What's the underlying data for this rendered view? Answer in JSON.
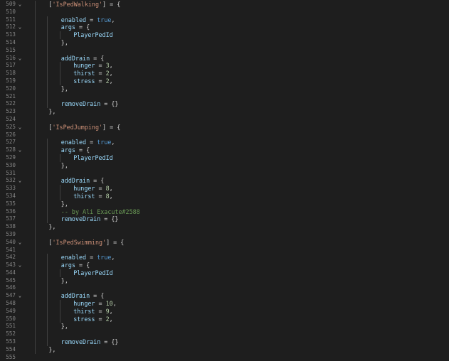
{
  "editor": {
    "lines": [
      {
        "n": "509",
        "fold": "⌄",
        "indent": 1,
        "tokens": [
          {
            "c": "t-pun",
            "t": "["
          },
          {
            "c": "t-str",
            "t": "'IsPedWalking'"
          },
          {
            "c": "t-pun",
            "t": "] = {"
          }
        ]
      },
      {
        "n": "510",
        "fold": "",
        "indent": 0,
        "tokens": []
      },
      {
        "n": "511",
        "fold": "",
        "indent": 2,
        "tokens": [
          {
            "c": "t-id",
            "t": "enabled"
          },
          {
            "c": "t-pun",
            "t": " = "
          },
          {
            "c": "t-kw",
            "t": "true"
          },
          {
            "c": "t-pun",
            "t": ","
          }
        ]
      },
      {
        "n": "512",
        "fold": "⌄",
        "indent": 2,
        "tokens": [
          {
            "c": "t-id",
            "t": "args"
          },
          {
            "c": "t-pun",
            "t": " = {"
          }
        ]
      },
      {
        "n": "513",
        "fold": "",
        "indent": 3,
        "tokens": [
          {
            "c": "t-fn",
            "t": "PlayerPedId"
          }
        ]
      },
      {
        "n": "514",
        "fold": "",
        "indent": 2,
        "tokens": [
          {
            "c": "t-pun",
            "t": "},"
          }
        ]
      },
      {
        "n": "515",
        "fold": "",
        "indent": 0,
        "tokens": []
      },
      {
        "n": "516",
        "fold": "⌄",
        "indent": 2,
        "tokens": [
          {
            "c": "t-id",
            "t": "addDrain"
          },
          {
            "c": "t-pun",
            "t": " = {"
          }
        ]
      },
      {
        "n": "517",
        "fold": "",
        "indent": 3,
        "tokens": [
          {
            "c": "t-id",
            "t": "hunger"
          },
          {
            "c": "t-pun",
            "t": " = "
          },
          {
            "c": "t-num",
            "t": "3"
          },
          {
            "c": "t-pun",
            "t": ","
          }
        ]
      },
      {
        "n": "518",
        "fold": "",
        "indent": 3,
        "tokens": [
          {
            "c": "t-id",
            "t": "thirst"
          },
          {
            "c": "t-pun",
            "t": " = "
          },
          {
            "c": "t-num",
            "t": "2"
          },
          {
            "c": "t-pun",
            "t": ","
          }
        ]
      },
      {
        "n": "519",
        "fold": "",
        "indent": 3,
        "tokens": [
          {
            "c": "t-id",
            "t": "stress"
          },
          {
            "c": "t-pun",
            "t": " = "
          },
          {
            "c": "t-num",
            "t": "2"
          },
          {
            "c": "t-pun",
            "t": ","
          }
        ]
      },
      {
        "n": "520",
        "fold": "",
        "indent": 2,
        "tokens": [
          {
            "c": "t-pun",
            "t": "},"
          }
        ]
      },
      {
        "n": "521",
        "fold": "",
        "indent": 0,
        "tokens": []
      },
      {
        "n": "522",
        "fold": "",
        "indent": 2,
        "tokens": [
          {
            "c": "t-id",
            "t": "removeDrain"
          },
          {
            "c": "t-pun",
            "t": " = {}"
          }
        ]
      },
      {
        "n": "523",
        "fold": "",
        "indent": 1,
        "tokens": [
          {
            "c": "t-pun",
            "t": "},"
          }
        ]
      },
      {
        "n": "524",
        "fold": "",
        "indent": 0,
        "tokens": []
      },
      {
        "n": "525",
        "fold": "⌄",
        "indent": 1,
        "tokens": [
          {
            "c": "t-pun",
            "t": "["
          },
          {
            "c": "t-str",
            "t": "'IsPedJumping'"
          },
          {
            "c": "t-pun",
            "t": "] = {"
          }
        ]
      },
      {
        "n": "526",
        "fold": "",
        "indent": 0,
        "tokens": []
      },
      {
        "n": "527",
        "fold": "",
        "indent": 2,
        "tokens": [
          {
            "c": "t-id",
            "t": "enabled"
          },
          {
            "c": "t-pun",
            "t": " = "
          },
          {
            "c": "t-kw",
            "t": "true"
          },
          {
            "c": "t-pun",
            "t": ","
          }
        ]
      },
      {
        "n": "528",
        "fold": "⌄",
        "indent": 2,
        "tokens": [
          {
            "c": "t-id",
            "t": "args"
          },
          {
            "c": "t-pun",
            "t": " = {"
          }
        ]
      },
      {
        "n": "529",
        "fold": "",
        "indent": 3,
        "tokens": [
          {
            "c": "t-fn",
            "t": "PlayerPedId"
          }
        ]
      },
      {
        "n": "530",
        "fold": "",
        "indent": 2,
        "tokens": [
          {
            "c": "t-pun",
            "t": "},"
          }
        ]
      },
      {
        "n": "531",
        "fold": "",
        "indent": 0,
        "tokens": []
      },
      {
        "n": "532",
        "fold": "⌄",
        "indent": 2,
        "tokens": [
          {
            "c": "t-id",
            "t": "addDrain"
          },
          {
            "c": "t-pun",
            "t": " = {"
          }
        ]
      },
      {
        "n": "533",
        "fold": "",
        "indent": 3,
        "tokens": [
          {
            "c": "t-id",
            "t": "hunger"
          },
          {
            "c": "t-pun",
            "t": " = "
          },
          {
            "c": "t-num",
            "t": "8"
          },
          {
            "c": "t-pun",
            "t": ","
          }
        ]
      },
      {
        "n": "534",
        "fold": "",
        "indent": 3,
        "tokens": [
          {
            "c": "t-id",
            "t": "thirst"
          },
          {
            "c": "t-pun",
            "t": " = "
          },
          {
            "c": "t-num",
            "t": "8"
          },
          {
            "c": "t-pun",
            "t": ","
          }
        ]
      },
      {
        "n": "535",
        "fold": "",
        "indent": 2,
        "tokens": [
          {
            "c": "t-pun",
            "t": "},"
          }
        ]
      },
      {
        "n": "536",
        "fold": "",
        "indent": 2,
        "tokens": [
          {
            "c": "t-cmt",
            "t": "-- by Ali Exacute#2588"
          }
        ]
      },
      {
        "n": "537",
        "fold": "",
        "indent": 2,
        "tokens": [
          {
            "c": "t-id",
            "t": "removeDrain"
          },
          {
            "c": "t-pun",
            "t": " = {}"
          }
        ]
      },
      {
        "n": "538",
        "fold": "",
        "indent": 1,
        "tokens": [
          {
            "c": "t-pun",
            "t": "},"
          }
        ]
      },
      {
        "n": "539",
        "fold": "",
        "indent": 0,
        "tokens": []
      },
      {
        "n": "540",
        "fold": "⌄",
        "indent": 1,
        "tokens": [
          {
            "c": "t-pun",
            "t": "["
          },
          {
            "c": "t-str",
            "t": "'IsPedSwimming'"
          },
          {
            "c": "t-pun",
            "t": "] = {"
          }
        ]
      },
      {
        "n": "541",
        "fold": "",
        "indent": 0,
        "tokens": []
      },
      {
        "n": "542",
        "fold": "",
        "indent": 2,
        "tokens": [
          {
            "c": "t-id",
            "t": "enabled"
          },
          {
            "c": "t-pun",
            "t": " = "
          },
          {
            "c": "t-kw",
            "t": "true"
          },
          {
            "c": "t-pun",
            "t": ","
          }
        ]
      },
      {
        "n": "543",
        "fold": "⌄",
        "indent": 2,
        "tokens": [
          {
            "c": "t-id",
            "t": "args"
          },
          {
            "c": "t-pun",
            "t": " = {"
          }
        ]
      },
      {
        "n": "544",
        "fold": "",
        "indent": 3,
        "tokens": [
          {
            "c": "t-fn",
            "t": "PlayerPedId"
          }
        ]
      },
      {
        "n": "545",
        "fold": "",
        "indent": 2,
        "tokens": [
          {
            "c": "t-pun",
            "t": "},"
          }
        ]
      },
      {
        "n": "546",
        "fold": "",
        "indent": 0,
        "tokens": []
      },
      {
        "n": "547",
        "fold": "⌄",
        "indent": 2,
        "tokens": [
          {
            "c": "t-id",
            "t": "addDrain"
          },
          {
            "c": "t-pun",
            "t": " = {"
          }
        ]
      },
      {
        "n": "548",
        "fold": "",
        "indent": 3,
        "tokens": [
          {
            "c": "t-id",
            "t": "hunger"
          },
          {
            "c": "t-pun",
            "t": " = "
          },
          {
            "c": "t-num",
            "t": "10"
          },
          {
            "c": "t-pun",
            "t": ","
          }
        ]
      },
      {
        "n": "549",
        "fold": "",
        "indent": 3,
        "tokens": [
          {
            "c": "t-id",
            "t": "thirst"
          },
          {
            "c": "t-pun",
            "t": " = "
          },
          {
            "c": "t-num",
            "t": "9"
          },
          {
            "c": "t-pun",
            "t": ","
          }
        ]
      },
      {
        "n": "550",
        "fold": "",
        "indent": 3,
        "tokens": [
          {
            "c": "t-id",
            "t": "stress"
          },
          {
            "c": "t-pun",
            "t": " = "
          },
          {
            "c": "t-num",
            "t": "2"
          },
          {
            "c": "t-pun",
            "t": ","
          }
        ]
      },
      {
        "n": "551",
        "fold": "",
        "indent": 2,
        "tokens": [
          {
            "c": "t-pun",
            "t": "},"
          }
        ]
      },
      {
        "n": "552",
        "fold": "",
        "indent": 0,
        "tokens": []
      },
      {
        "n": "553",
        "fold": "",
        "indent": 2,
        "tokens": [
          {
            "c": "t-id",
            "t": "removeDrain"
          },
          {
            "c": "t-pun",
            "t": " = {}"
          }
        ]
      },
      {
        "n": "554",
        "fold": "",
        "indent": 1,
        "tokens": [
          {
            "c": "t-pun",
            "t": "},"
          }
        ]
      },
      {
        "n": "555",
        "fold": "",
        "indent": 0,
        "tokens": []
      }
    ]
  }
}
